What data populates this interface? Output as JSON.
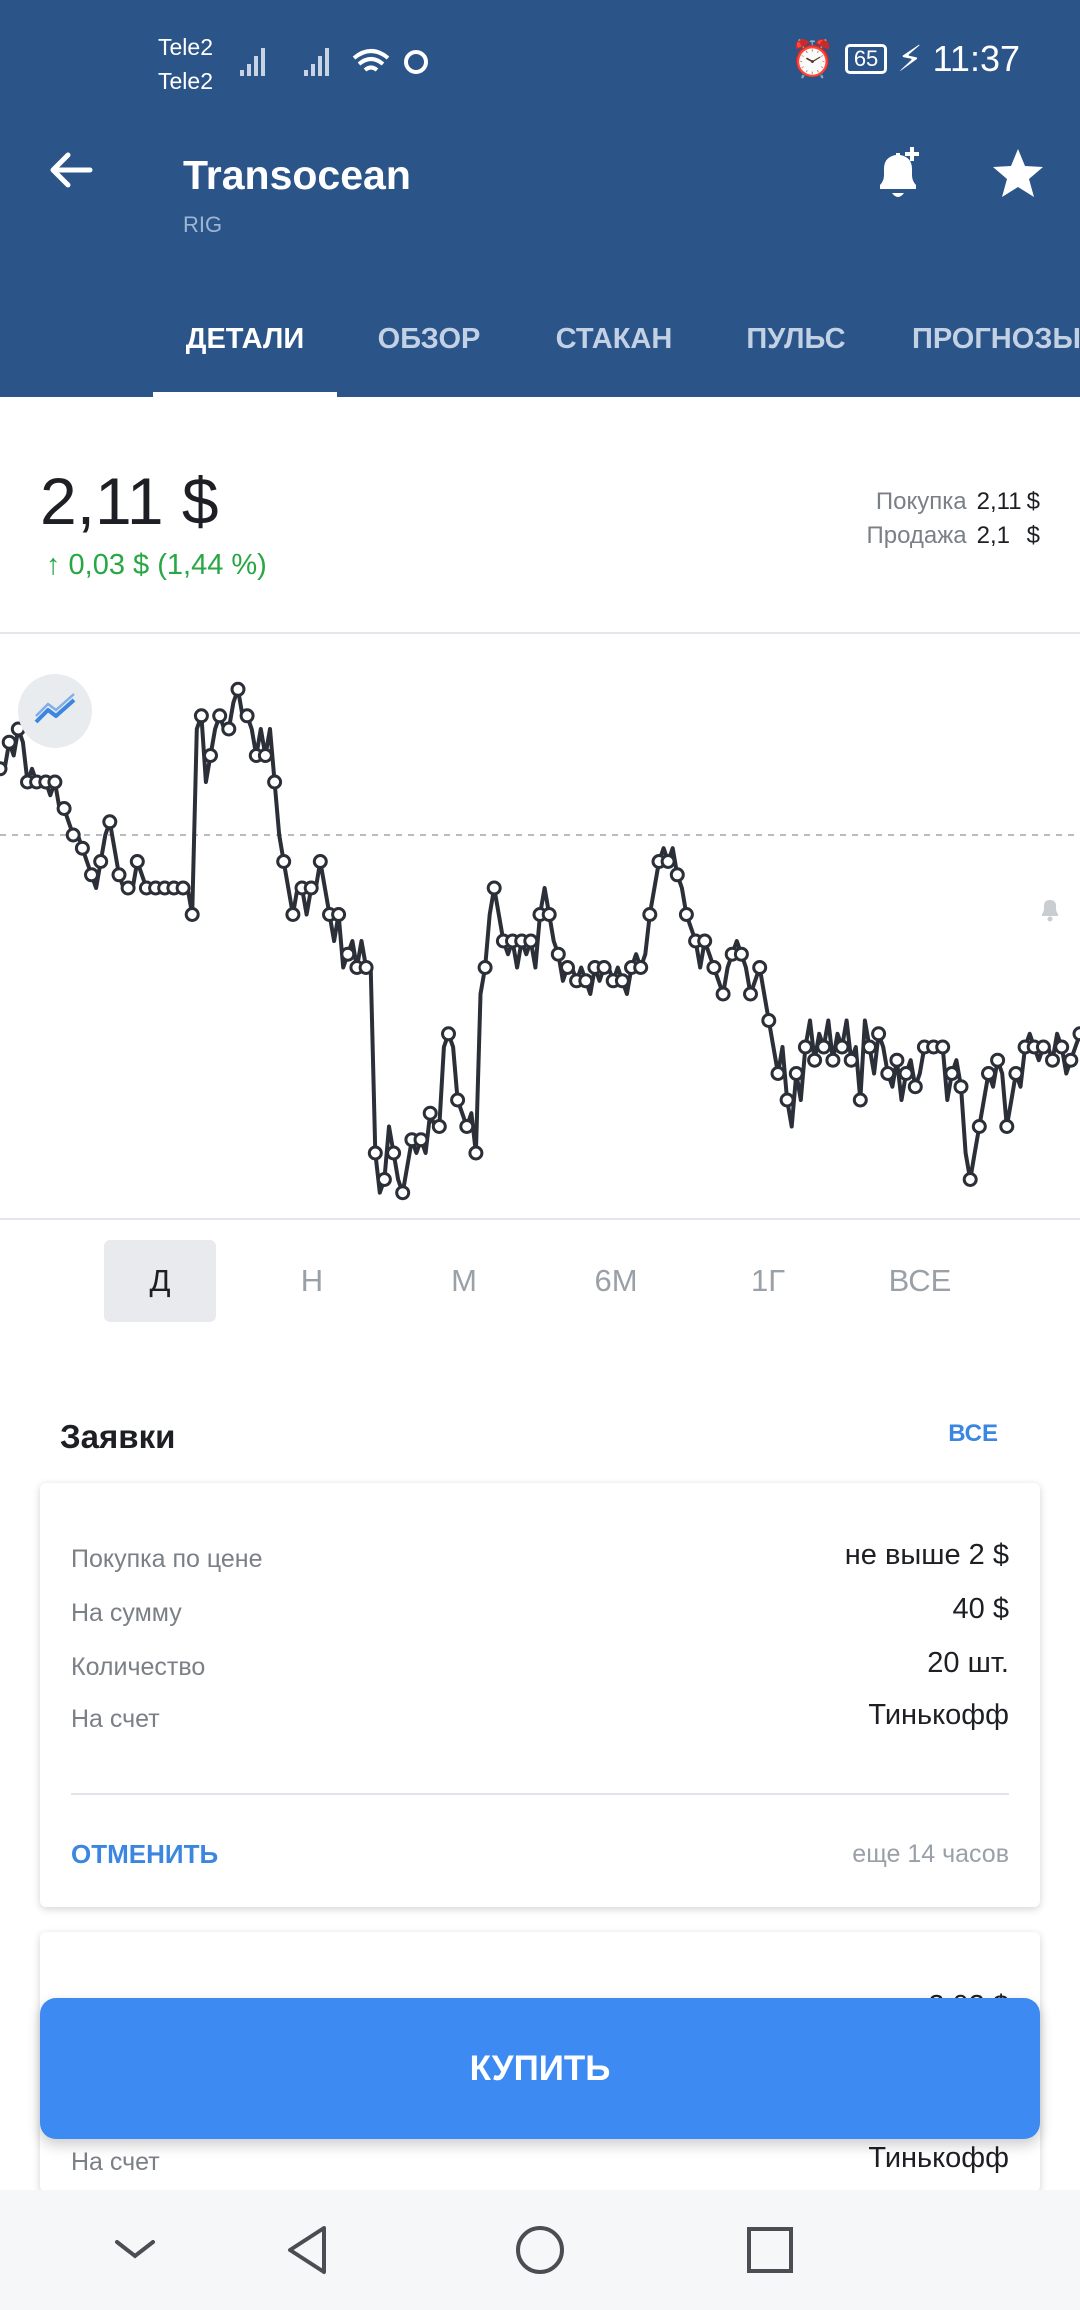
{
  "status_bar": {
    "carrier1": "Tele2",
    "carrier2": "Tele2",
    "battery": "65",
    "time": "11:37"
  },
  "header": {
    "title": "Transocean",
    "ticker": "RIG",
    "tabs": [
      "ДЕТАЛИ",
      "ОБЗОР",
      "СТАКАН",
      "ПУЛЬС",
      "ПРОГНОЗЫ"
    ],
    "active_tab": "ДЕТАЛИ"
  },
  "quote": {
    "price": "2,11 $",
    "change": "↑ 0,03 $ (1,44 %)",
    "bid_label": "Покупка",
    "bid_value": "2,11",
    "ask_label": "Продажа",
    "ask_value": "2,1",
    "currency": "$",
    "change_color": "#28a745"
  },
  "chart_data": {
    "type": "line",
    "series": [
      {
        "values": [
          2.105,
          2.105,
          2.115,
          2.11,
          2.12,
          2.115,
          2.1,
          2.105,
          2.1,
          2.1,
          2.1,
          2.095,
          2.1,
          2.09,
          2.09,
          2.085,
          2.08,
          2.08,
          2.075,
          2.07,
          2.065,
          2.06,
          2.07,
          2.08,
          2.085,
          2.075,
          2.065,
          2.06,
          2.06,
          2.06,
          2.07,
          2.065,
          2.06,
          2.06,
          2.06,
          2.06,
          2.06,
          2.06,
          2.06,
          2.06,
          2.06,
          2.06,
          2.05,
          2.12,
          2.125,
          2.1,
          2.11,
          2.12,
          2.125,
          2.12,
          2.12,
          2.13,
          2.135,
          2.125,
          2.125,
          2.12,
          2.11,
          2.12,
          2.11,
          2.12,
          2.1,
          2.08,
          2.07,
          2.06,
          2.05,
          2.06,
          2.06,
          2.05,
          2.06,
          2.06,
          2.07,
          2.06,
          2.05,
          2.04,
          2.05,
          2.03,
          2.035,
          2.04,
          2.03,
          2.04,
          2.03,
          2.03,
          1.96,
          1.945,
          1.95,
          1.97,
          1.96,
          1.95,
          1.945,
          1.955,
          1.965,
          1.96,
          1.965,
          1.96,
          1.975,
          1.97,
          1.97,
          2.0,
          2.005,
          2.0,
          1.98,
          1.975,
          1.97,
          1.975,
          1.96,
          2.02,
          2.03,
          2.05,
          2.06,
          2.05,
          2.04,
          2.035,
          2.04,
          2.03,
          2.04,
          2.035,
          2.04,
          2.03,
          2.05,
          2.06,
          2.05,
          2.04,
          2.035,
          2.025,
          2.03,
          2.03,
          2.025,
          2.03,
          2.025,
          2.02,
          2.03,
          2.025,
          2.03,
          2.03,
          2.025,
          2.03,
          2.025,
          2.02,
          2.03,
          2.035,
          2.03,
          2.035,
          2.05,
          2.06,
          2.07,
          2.075,
          2.07,
          2.075,
          2.065,
          2.06,
          2.05,
          2.045,
          2.04,
          2.03,
          2.04,
          2.035,
          2.03,
          2.025,
          2.02,
          2.03,
          2.035,
          2.04,
          2.035,
          2.03,
          2.02,
          2.025,
          2.03,
          2.02,
          2.01,
          2.0,
          1.99,
          2.0,
          1.98,
          1.97,
          1.99,
          1.98,
          2.0,
          2.01,
          1.995,
          2.005,
          2.0,
          2.01,
          1.995,
          2.005,
          2.0,
          2.01,
          1.995,
          2.0,
          1.98,
          2.01,
          2.0,
          1.99,
          2.005,
          2.0,
          1.99,
          1.985,
          1.995,
          1.98,
          1.99,
          1.995,
          1.985,
          1.99,
          2.0,
          2.0,
          2.0,
          2.0,
          2.0,
          1.98,
          1.99,
          1.995,
          1.985,
          1.96,
          1.95,
          1.96,
          1.97,
          1.98,
          1.99,
          1.985,
          1.995,
          1.99,
          1.97,
          1.98,
          1.99,
          1.985,
          2.0,
          2.005,
          2.0,
          1.995,
          2.0,
          2.0,
          1.995,
          2.005,
          2.0,
          1.99,
          1.995,
          2.0,
          2.005
        ]
      }
    ],
    "reference_line": 2.08
  },
  "periods": [
    "Д",
    "Н",
    "М",
    "6М",
    "1Г",
    "ВСЕ"
  ],
  "active_period": "Д",
  "orders": {
    "title": "Заявки",
    "all_label": "ВСЕ",
    "card1": {
      "rows": [
        {
          "label": "Покупка по цене",
          "value": "не выше  2 $"
        },
        {
          "label": "На сумму",
          "value": "40 $"
        },
        {
          "label": "Количество",
          "value": "20 шт."
        },
        {
          "label": "На счет",
          "value": "Тинькофф"
        }
      ],
      "cancel": "ОТМЕНИТЬ",
      "remaining": "еще 14 часов"
    },
    "card2": {
      "partial_value": "2,02 $",
      "last_row": {
        "label": "На счет",
        "value": "Тинькофф"
      }
    }
  },
  "buy_button": "КУПИТЬ"
}
